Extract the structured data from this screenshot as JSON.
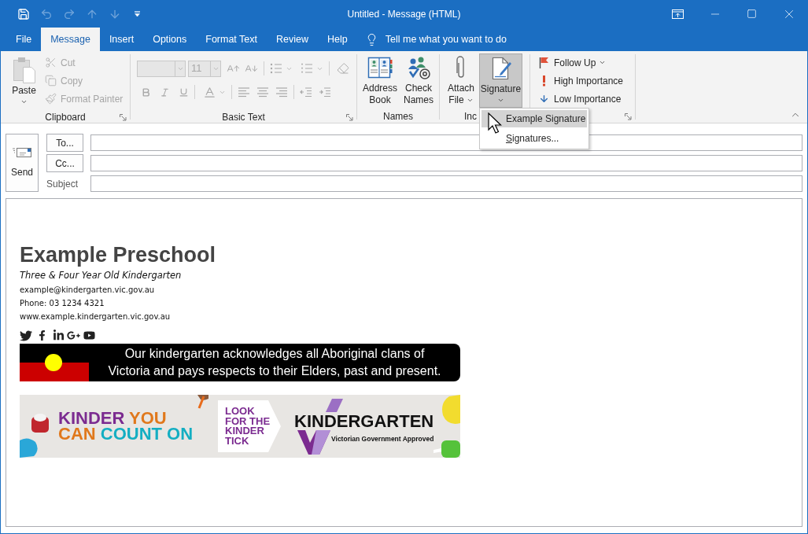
{
  "window": {
    "title": "Untitled - Message (HTML)"
  },
  "quick_access": [
    {
      "kind": "save",
      "disabled": false
    },
    {
      "kind": "undo",
      "disabled": true
    },
    {
      "kind": "redo",
      "disabled": true
    },
    {
      "kind": "up",
      "disabled": true
    },
    {
      "kind": "down",
      "disabled": true
    },
    {
      "kind": "customize",
      "disabled": false
    }
  ],
  "tabs": [
    {
      "label": "File",
      "selected": false
    },
    {
      "label": "Message",
      "selected": true
    },
    {
      "label": "Insert",
      "selected": false
    },
    {
      "label": "Options",
      "selected": false
    },
    {
      "label": "Format Text",
      "selected": false
    },
    {
      "label": "Review",
      "selected": false
    },
    {
      "label": "Help",
      "selected": false
    }
  ],
  "tell_me": {
    "label": "Tell me what you want to do"
  },
  "ribbon": {
    "clipboard": {
      "label": "Clipboard",
      "paste": {
        "label": "Paste",
        "disabled": false
      },
      "cut": {
        "label": "Cut",
        "disabled": true
      },
      "copy": {
        "label": "Copy",
        "disabled": true
      },
      "format_painter": {
        "label": "Format Painter",
        "disabled": true
      }
    },
    "basic_text": {
      "label": "Basic Text",
      "disabled": true,
      "font_size": "11"
    },
    "names": {
      "label": "Names",
      "address_book": "Address Book",
      "check_names": "Check Names"
    },
    "include": {
      "label": "Inc",
      "attach_file": "Attach File",
      "signature": {
        "label": "Signature",
        "pressed": true
      }
    },
    "tags": {
      "follow_up": "Follow Up",
      "high_importance": "High Importance",
      "low_importance": "Low Importance"
    }
  },
  "signature_menu": {
    "expanded": true,
    "items": [
      {
        "label": "Example Signature",
        "selected": true,
        "access_key_underlined": false
      },
      {
        "label": "Signatures...",
        "selected": false,
        "access_key_underlined": true
      }
    ]
  },
  "compose": {
    "send": "Send",
    "to": "To...",
    "cc": "Cc...",
    "subject_label": "Subject"
  },
  "signature": {
    "name": "Example Preschool",
    "tagline": "Three & Four Year Old Kindergarten",
    "email": "example@kindergarten.vic.gov.au",
    "phone": "Phone: 03 1234 4321",
    "website": "www.example.kindergarten.vic.gov.au",
    "acknowledgement": "Our kindergarten acknowledges all Aboriginal clans of Victoria and pays respects to their Elders, past and present.",
    "banner": {
      "headline": [
        [
          {
            "text": "KINDER",
            "color": "#7b2b90"
          },
          {
            "text": "YOU",
            "color": "#e0781c"
          }
        ],
        [
          {
            "text": "CAN",
            "color": "#e0781c"
          },
          {
            "text": "COUNT ON",
            "color": "#13aec2"
          }
        ]
      ],
      "tick_prompt": "LOOK FOR THE KINDER TICK",
      "brand": "KINDERGARTEN",
      "approval": "Victorian Government Approved"
    }
  }
}
